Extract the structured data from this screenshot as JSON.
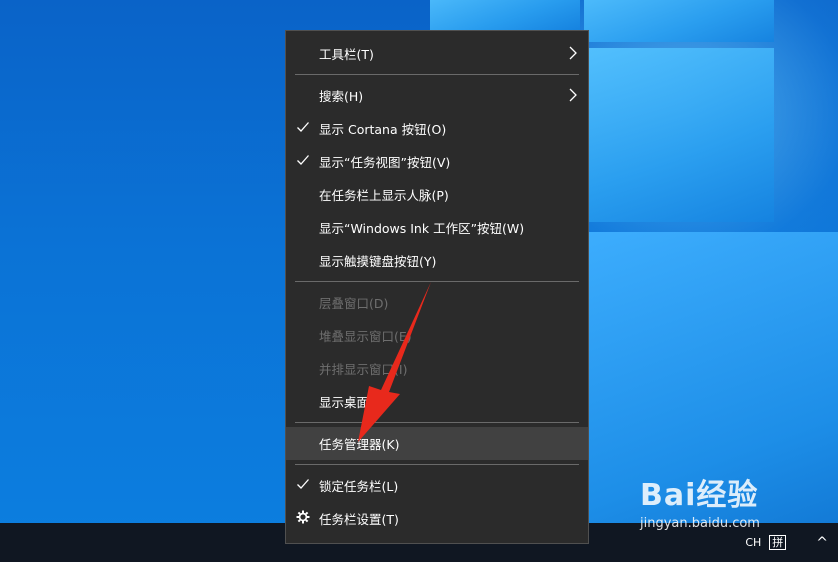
{
  "menu": {
    "items": [
      {
        "label": "工具栏(T)",
        "submenu": true
      },
      {
        "label": "搜索(H)",
        "submenu": true
      },
      {
        "label": "显示 Cortana 按钮(O)",
        "checked": true
      },
      {
        "label": "显示“任务视图”按钮(V)",
        "checked": true
      },
      {
        "label": "在任务栏上显示人脉(P)"
      },
      {
        "label": "显示“Windows Ink 工作区”按钮(W)"
      },
      {
        "label": "显示触摸键盘按钮(Y)"
      },
      {
        "label": "层叠窗口(D)",
        "disabled": true
      },
      {
        "label": "堆叠显示窗口(E)",
        "disabled": true
      },
      {
        "label": "并排显示窗口(I)",
        "disabled": true
      },
      {
        "label": "显示桌面(S)"
      },
      {
        "label": "任务管理器(K)",
        "highlighted": true
      },
      {
        "label": "锁定任务栏(L)",
        "checked": true
      },
      {
        "label": "任务栏设置(T)",
        "icon": "gear-icon"
      }
    ]
  },
  "taskbar": {
    "tray_chevron": "^",
    "ime_mode": "CH",
    "ime_label": "拼"
  },
  "watermark": {
    "logo": "Bai经验",
    "url": "jingyan.baidu.com"
  },
  "colors": {
    "menu_bg": "#2b2b2b",
    "menu_hover": "#414141",
    "annotation_arrow": "#e8291c"
  }
}
